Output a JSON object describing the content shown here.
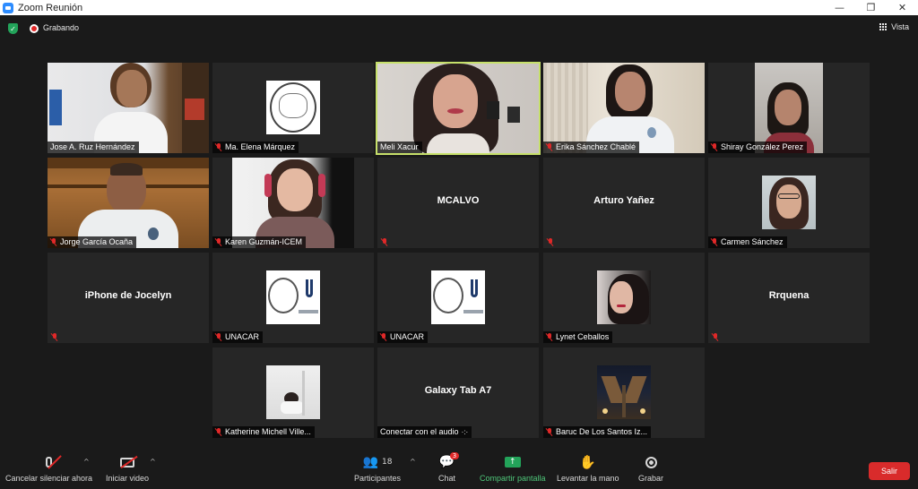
{
  "window": {
    "title": "Zoom Reunión",
    "minimize_glyph": "—",
    "restore_glyph": "❐",
    "close_glyph": "✕"
  },
  "topbar": {
    "recording_label": "Grabando",
    "view_label": "Vista"
  },
  "participants": [
    {
      "name": "Jose A. Ruz Hernández",
      "muted": false
    },
    {
      "name": "Ma. Elena Márquez",
      "muted": true
    },
    {
      "name": "Meli Xacur",
      "muted": false,
      "active_speaker": true
    },
    {
      "name": "Erika Sánchez Chablé",
      "muted": true
    },
    {
      "name": "Shiray González Perez",
      "muted": true
    },
    {
      "name": "Jorge García Ocaña",
      "muted": true
    },
    {
      "name": "Karen Guzmán-ICEM",
      "muted": true
    },
    {
      "display": "MCALVO",
      "muted": true
    },
    {
      "display": "Arturo Yañez",
      "muted": true
    },
    {
      "name": "Carmen Sánchez",
      "muted": true
    },
    {
      "display": "iPhone de Jocelyn",
      "muted": true
    },
    {
      "name": "UNACAR",
      "muted": true
    },
    {
      "name": "UNACAR",
      "muted": true
    },
    {
      "name": "Lynet Ceballos",
      "muted": true
    },
    {
      "display": "Rrquena",
      "muted": true
    },
    {
      "name": "Katherine Michell Ville...",
      "muted": true
    },
    {
      "display": "Galaxy Tab A7",
      "name": "Conectar con el audio",
      "muted": false
    },
    {
      "name": "Baruc De Los Santos Iz...",
      "muted": true
    }
  ],
  "toolbar": {
    "mute_label": "Cancelar silenciar ahora",
    "video_label": "Iniciar video",
    "participants_label": "Participantes",
    "participants_count": "18",
    "chat_label": "Chat",
    "chat_badge": "3",
    "share_label": "Compartir pantalla",
    "raise_hand_label": "Levantar la mano",
    "record_label": "Grabar",
    "leave_label": "Salir"
  },
  "colors": {
    "background": "#1a1a1a",
    "tile": "#262626",
    "active_border": "#c6e06a",
    "leave": "#d92b2b",
    "share": "#23a35a"
  }
}
